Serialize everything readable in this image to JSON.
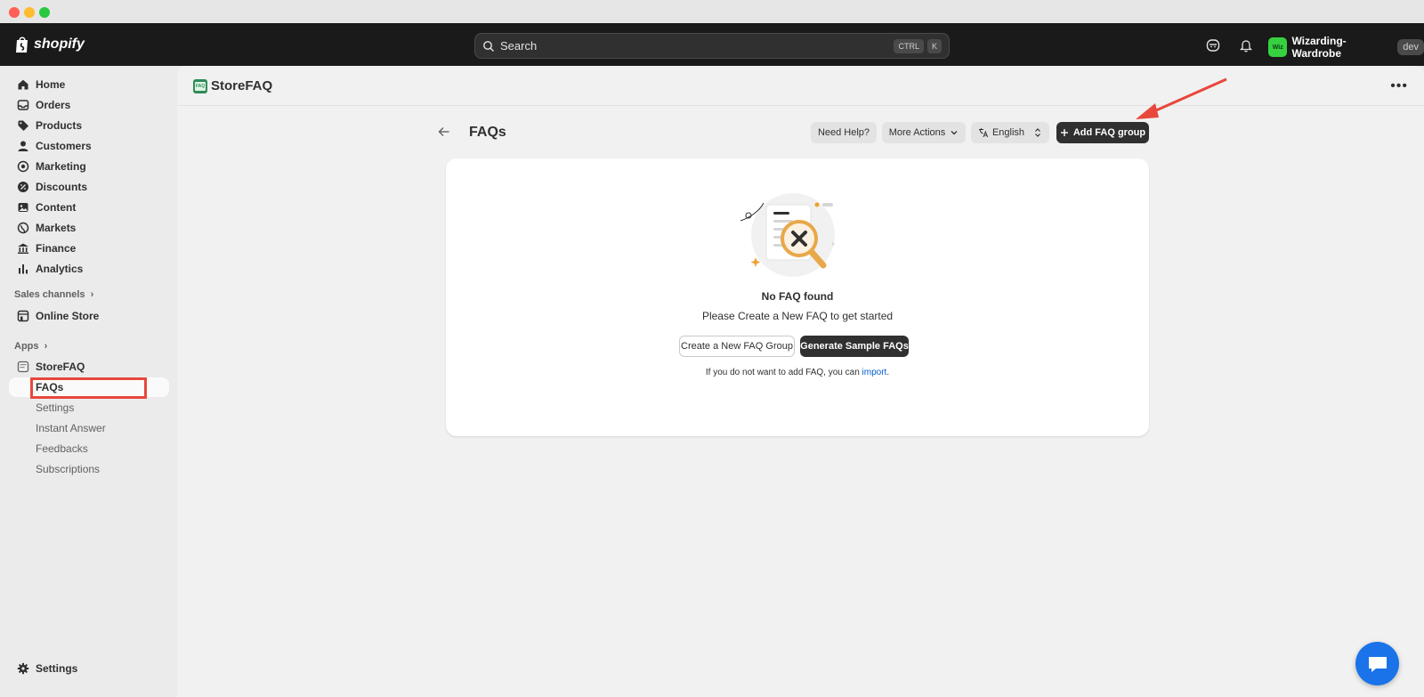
{
  "topbar": {
    "logo_text": "shopify",
    "search_label": "Search",
    "shortcut_keys": [
      "CTRL",
      "K"
    ],
    "store_avatar": "Wiz",
    "store_name": "Wizarding-Wardrobe",
    "store_badge": "dev"
  },
  "sidebar": {
    "items": [
      {
        "label": "Home",
        "icon": "home-icon"
      },
      {
        "label": "Orders",
        "icon": "inbox-icon"
      },
      {
        "label": "Products",
        "icon": "tag-icon"
      },
      {
        "label": "Customers",
        "icon": "person-icon"
      },
      {
        "label": "Marketing",
        "icon": "target-icon"
      },
      {
        "label": "Discounts",
        "icon": "discount-icon"
      },
      {
        "label": "Content",
        "icon": "content-icon"
      },
      {
        "label": "Markets",
        "icon": "globe-icon"
      },
      {
        "label": "Finance",
        "icon": "bank-icon"
      },
      {
        "label": "Analytics",
        "icon": "bar-chart-icon"
      }
    ],
    "sales_channels_heading": "Sales channels",
    "online_store": "Online Store",
    "apps_heading": "Apps",
    "app_name": "StoreFAQ",
    "app_subitems": [
      "FAQs",
      "Settings",
      "Instant Answer",
      "Feedbacks",
      "Subscriptions"
    ],
    "settings": "Settings"
  },
  "content": {
    "app_title": "StoreFAQ",
    "app_logo_text": "FAQ",
    "page_title": "FAQs",
    "need_help": "Need Help?",
    "more_actions": "More Actions",
    "language": "English",
    "add_group": "Add FAQ group",
    "empty_title": "No FAQ found",
    "empty_subtitle": "Please Create a New FAQ to get started",
    "create_button": "Create a New FAQ Group",
    "generate_button": "Generate Sample FAQs",
    "import_prefix": "If you do not want to add FAQ, you can ",
    "import_link": "import",
    "import_suffix": "."
  },
  "colors": {
    "topbar": "#1a1a1a",
    "accent_dark": "#303030",
    "link": "#005bd3",
    "annotation_red": "#e8473b",
    "chat_blue": "#1a73e8",
    "store_green": "#36d13f"
  }
}
